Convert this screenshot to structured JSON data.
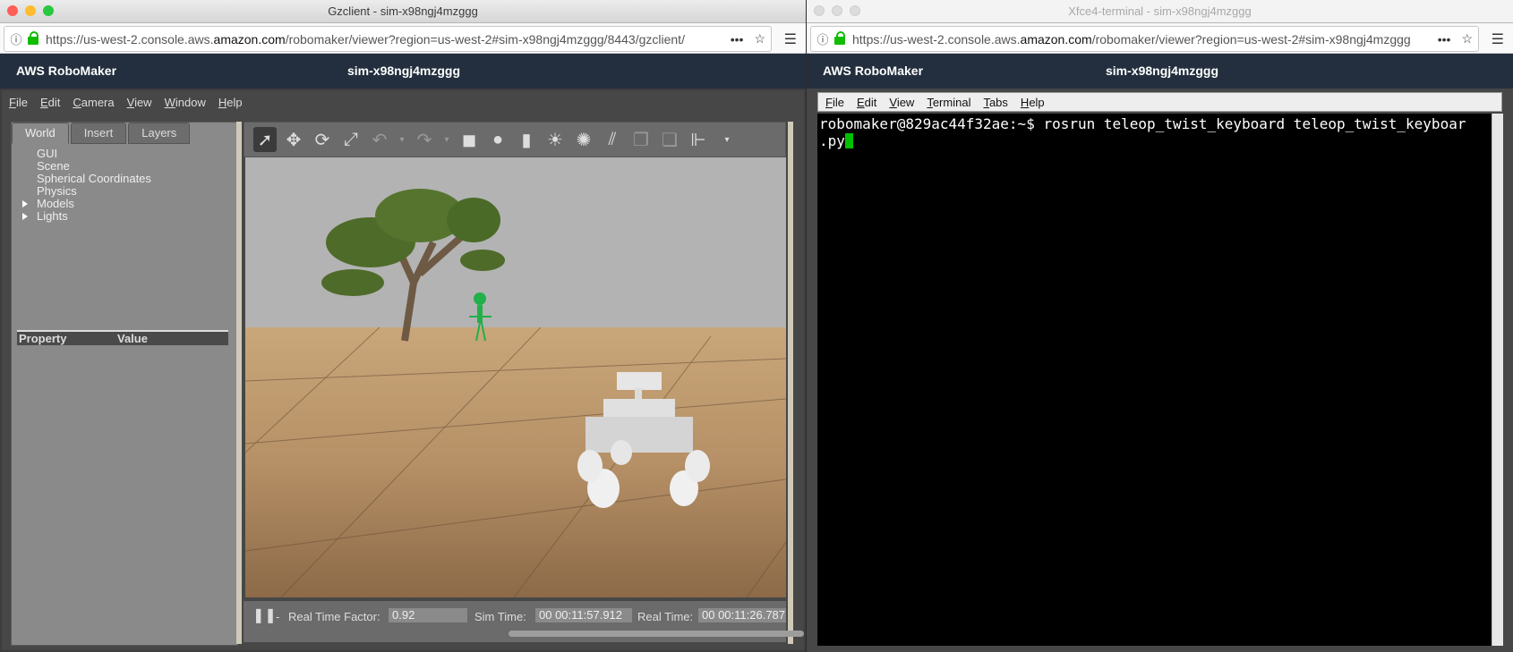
{
  "left_window": {
    "title": "Gzclient - sim-x98ngj4mzggg",
    "url_prefix": "https://us-west-2.console.aws.",
    "url_domain": "amazon.com",
    "url_path": "/robomaker/viewer?region=us-west-2#sim-x98ngj4mzggg/8443/gzclient/",
    "aws_brand": "AWS RoboMaker",
    "sim_id": "sim-x98ngj4mzggg",
    "menu": [
      "File",
      "Edit",
      "Camera",
      "View",
      "Window",
      "Help"
    ],
    "tabs": [
      "World",
      "Insert",
      "Layers"
    ],
    "tree": [
      "GUI",
      "Scene",
      "Spherical Coordinates",
      "Physics",
      "Models",
      "Lights"
    ],
    "prop_header": "Property",
    "value_header": "Value",
    "status": {
      "rtf_label": "Real Time Factor:",
      "rtf_value": "0.92",
      "sim_label": "Sim Time:",
      "sim_value": "00 00:11:57.912",
      "real_label": "Real Time:",
      "real_value": "00 00:11:26.787"
    }
  },
  "right_window": {
    "title": "Xfce4-terminal - sim-x98ngj4mzggg",
    "url_prefix": "https://us-west-2.console.aws.",
    "url_domain": "amazon.com",
    "url_path": "/robomaker/viewer?region=us-west-2#sim-x98ngj4mzggg",
    "aws_brand": "AWS RoboMaker",
    "sim_id": "sim-x98ngj4mzggg",
    "menu": [
      "File",
      "Edit",
      "View",
      "Terminal",
      "Tabs",
      "Help"
    ],
    "terminal_line1": "robomaker@829ac44f32ae:~$ rosrun teleop_twist_keyboard teleop_twist_keyboar",
    "terminal_line2": ".py"
  },
  "colors": {
    "aws_header": "#232f3e",
    "lock_green": "#12bc00",
    "cursor_green": "#00c000"
  }
}
